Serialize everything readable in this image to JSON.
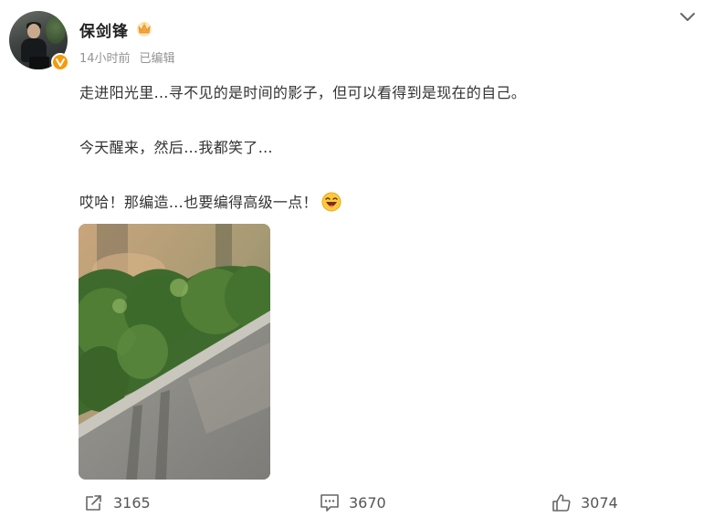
{
  "user": {
    "name": "保剑锋",
    "verified_color": "#f59a0a"
  },
  "meta": {
    "time": "14小时前",
    "edited": "已编辑"
  },
  "post": {
    "line1": "走进阳光里…寻不见的是时间的影子，但可以看得到是现在的自己。",
    "line2": "今天醒来，然后…我都笑了…",
    "line3": "哎哈！那编造…也要编得高级一点！"
  },
  "icons": {
    "menu": "chevron-down-icon",
    "badge": "crown-icon",
    "emoji": "laughing-emoji-icon"
  },
  "actions": {
    "repost": "3165",
    "comment": "3670",
    "like": "3074"
  }
}
